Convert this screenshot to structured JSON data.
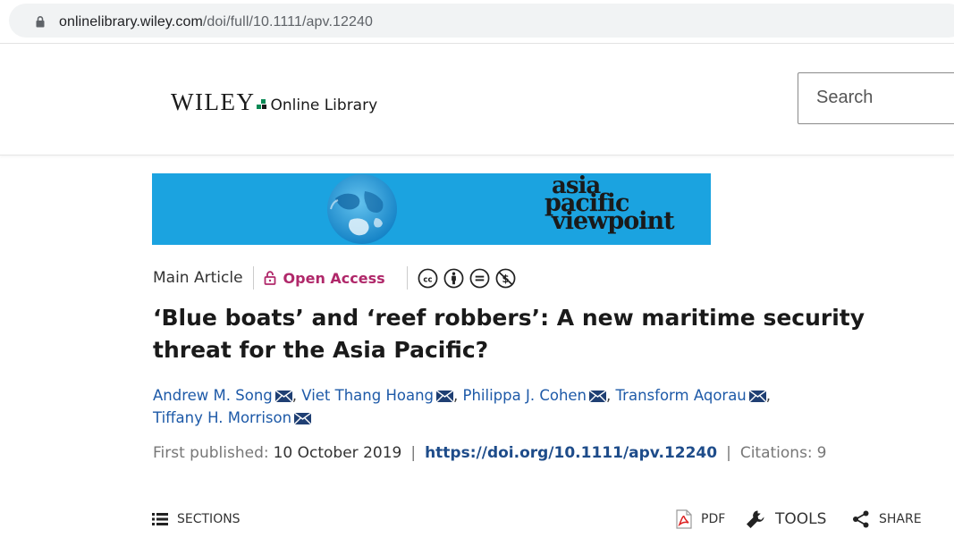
{
  "browser": {
    "url_host": "onlinelibrary.wiley.com",
    "url_path": "/doi/full/10.1111/apv.12240"
  },
  "header": {
    "logo_brand": "WILEY",
    "logo_product": "Online Library",
    "search_placeholder": "Search"
  },
  "banner": {
    "journal_line1": "asia",
    "journal_line2": "pacific",
    "journal_line3": "viewpoint",
    "background_color": "#1ba3e0"
  },
  "article_meta": {
    "article_type": "Main Article",
    "access_label": "Open Access",
    "access_color": "#b0286a",
    "license_icons": [
      "cc-icon",
      "by-attribution-icon",
      "noderivs-icon",
      "noncommercial-icon"
    ]
  },
  "article": {
    "title": "‘Blue boats’ and ‘reef robbers’: A new maritime security threat for the Asia Pacific?"
  },
  "authors": [
    {
      "name": "Andrew M. Song"
    },
    {
      "name": "Viet Thang Hoang"
    },
    {
      "name": "Philippa J. Cohen"
    },
    {
      "name": "Transform Aqorau"
    },
    {
      "name": "Tiffany H. Morrison"
    }
  ],
  "author_separator": ",",
  "publication": {
    "first_published_label": "First published:",
    "first_published_value": "10 October 2019",
    "separator": "|",
    "doi": "https://doi.org/10.1111/apv.12240",
    "citations_label": "Citations:",
    "citations_value": "9"
  },
  "toolbar": {
    "sections_label": "SECTIONS",
    "pdf_label": "PDF",
    "tools_label": "TOOLS",
    "share_label": "SHARE"
  }
}
